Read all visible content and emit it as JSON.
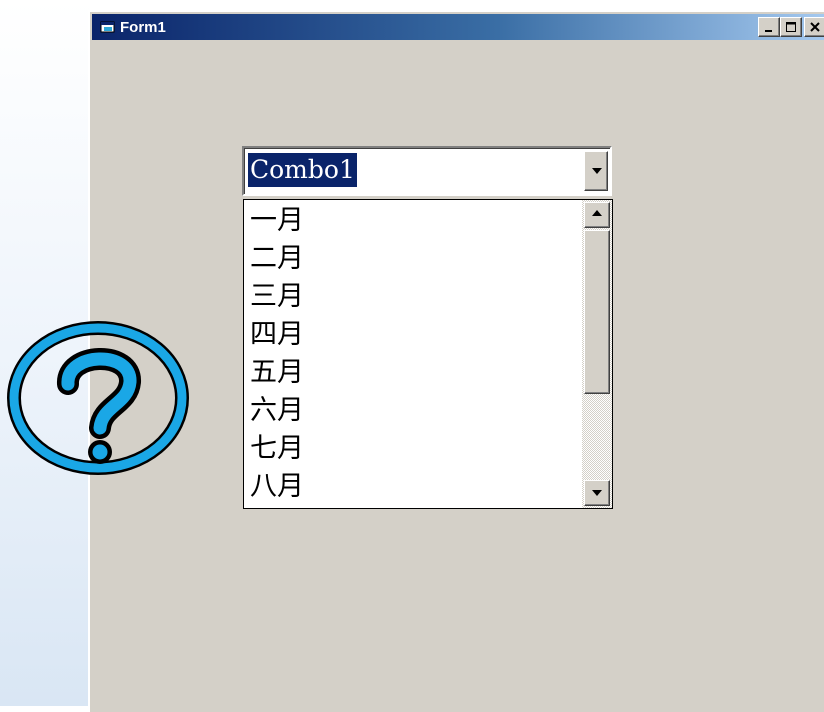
{
  "window": {
    "title": "Form1",
    "buttons": {
      "minimize": "_",
      "maximize": "□",
      "close": "×"
    }
  },
  "combo": {
    "text": "Combo1",
    "items": [
      "一月",
      "二月",
      "三月",
      "四月",
      "五月",
      "六月",
      "七月",
      "八月"
    ]
  },
  "help_badge": {
    "icon": "question-mark-icon",
    "color": "#1aa7e6"
  },
  "colors": {
    "titlebar_start": "#0a246a",
    "face": "#d4d0c8",
    "selection": "#0a246a"
  }
}
